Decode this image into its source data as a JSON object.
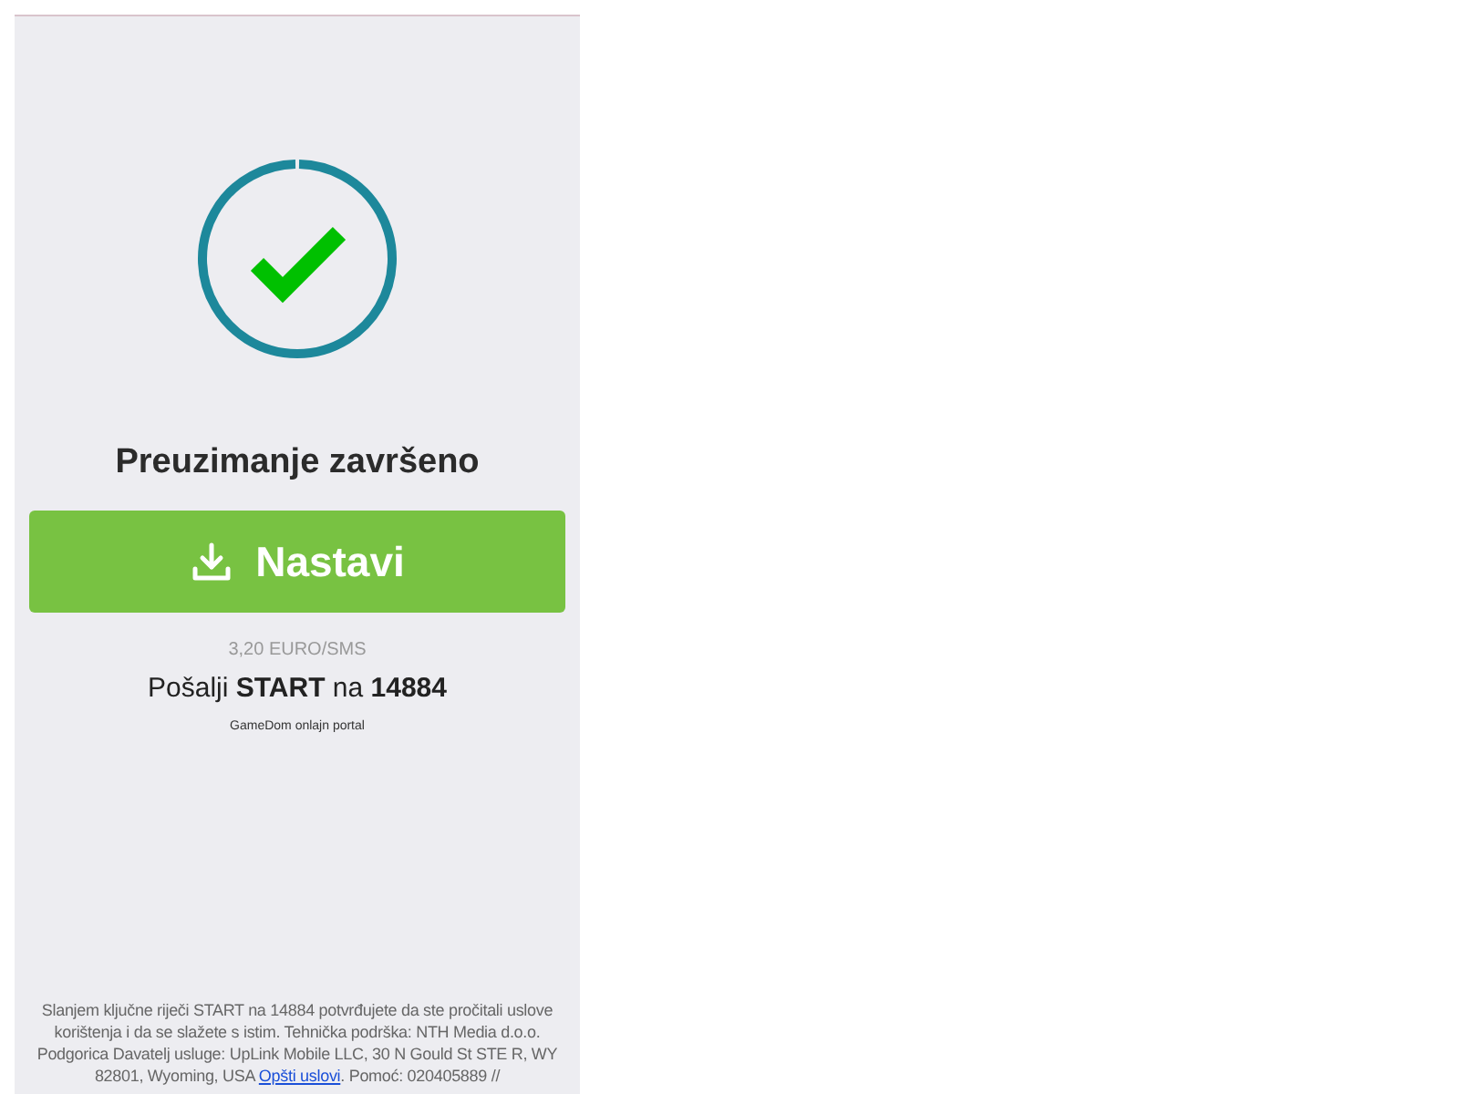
{
  "title": "Preuzimanje završeno",
  "button": {
    "label": "Nastavi"
  },
  "price": "3,20 EURO/SMS",
  "instruction": "Pošalji **START** na **14884**",
  "brand": "GameDom onlajn portal",
  "footer": {
    "before": "Slanjem ključne riječi START na 14884 potvrđujete da ste pročitali uslove korištenja i da se slažete s istim. Tehnička podrška: NTH Media d.o.o. Podgorica Davatelj usluge: UpLink Mobile LLC, 30 N Gould St STE R, WY 82801, Wyoming, USA",
    "link": "Opšti uslovi",
    "after": ". Pomoć: 020405889 //"
  }
}
